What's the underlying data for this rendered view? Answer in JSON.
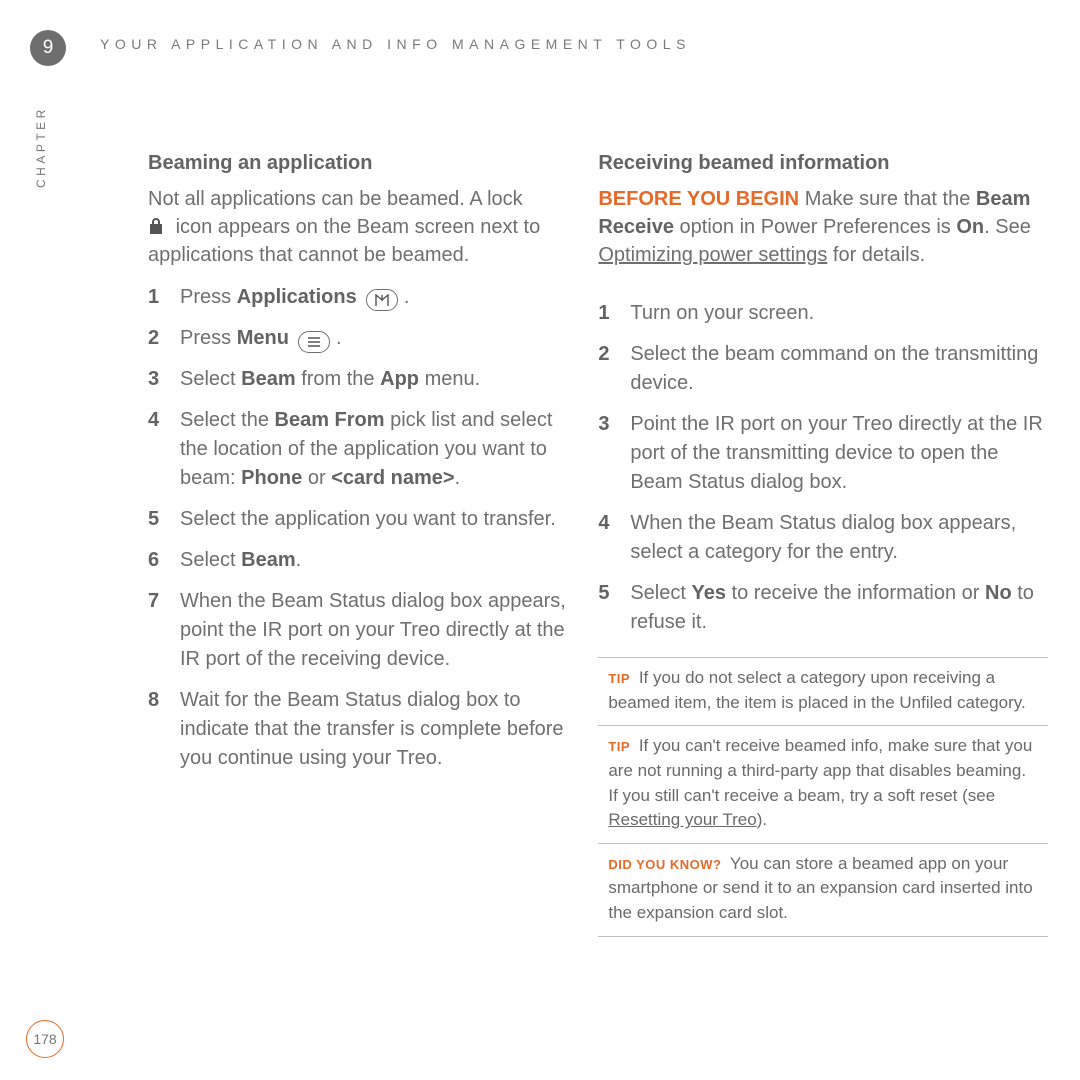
{
  "chapter": {
    "number": "9",
    "label": "CHAPTER"
  },
  "header": {
    "title": "YOUR APPLICATION AND INFO MANAGEMENT TOOLS"
  },
  "page_number": "178",
  "left": {
    "title": "Beaming an application",
    "intro_a": "Not all applications can be beamed. A lock",
    "intro_b": "icon appears on the Beam screen next to applications that cannot be beamed.",
    "steps": {
      "s1a": "Press ",
      "s1b": "Applications",
      "s1c": " .",
      "s2a": "Press ",
      "s2b": "Menu",
      "s2c": " .",
      "s3a": "Select ",
      "s3b": "Beam",
      "s3c": " from the ",
      "s3d": "App",
      "s3e": " menu.",
      "s4a": "Select the ",
      "s4b": "Beam From",
      "s4c": " pick list and select the location of the application you want to beam: ",
      "s4d": "Phone",
      "s4e": " or ",
      "s4f": "<card name>",
      "s4g": ".",
      "s5": "Select the application you want to transfer.",
      "s6a": "Select ",
      "s6b": "Beam",
      "s6c": ".",
      "s7": "When the Beam Status dialog box appears, point the IR port on your Treo directly at the IR port of the receiving device.",
      "s8": "Wait for the Beam Status dialog box to indicate that the transfer is complete before you continue using your Treo."
    }
  },
  "right": {
    "title": "Receiving beamed information",
    "before_label": "BEFORE YOU BEGIN",
    "before_a": "Make sure that the ",
    "before_b": "Beam Receive",
    "before_c": " option in Power Preferences is ",
    "before_d": "On",
    "before_e": ". See ",
    "before_link": "Optimizing power settings",
    "before_f": " for details.",
    "steps": {
      "s1": "Turn on your screen.",
      "s2": "Select the beam command on the transmitting device.",
      "s3": "Point the IR port on your Treo directly at the IR port of the transmitting device to open the Beam Status dialog box.",
      "s4": "When the Beam Status dialog box appears, select a category for the entry.",
      "s5a": "Select ",
      "s5b": "Yes",
      "s5c": " to receive the information or ",
      "s5d": "No",
      "s5e": " to refuse it."
    },
    "tips": {
      "tip_label": "TIP",
      "dyk_label": "DID YOU KNOW?",
      "t1": "If you do not select a category upon receiving a beamed item, the item is placed in the Unfiled category.",
      "t2a": "If you can't receive beamed info, make sure that you are not running a third-party app that disables beaming. If you still can't receive a beam, try a soft reset (see ",
      "t2link": "Resetting your Treo",
      "t2b": ").",
      "t3": "You can store a beamed app on your smartphone or send it to an expansion card inserted into the expansion card slot."
    }
  }
}
